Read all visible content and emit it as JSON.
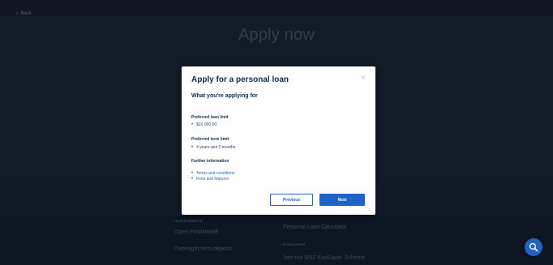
{
  "page": {
    "back_label": "Back",
    "title": "Apply now",
    "bg_left_section_label": "INVESTMENTS",
    "bg_left_items": [
      "Open FirstWealth",
      "Overnight term deposit"
    ],
    "bg_right_items_top": "Personal Loan Calculator",
    "bg_right_section_label": "KIWISAVER",
    "bg_right_items_bottom": "Join the BNZ KiwiSaver Scheme"
  },
  "modal": {
    "title": "Apply for a personal loan",
    "close_icon": "close-icon",
    "subtitle": "What you're applying for",
    "loan_limit_label": "Preferred loan limit",
    "loan_limit_value": "$10,000.00",
    "term_limit_label": "Preferred term limit",
    "term_limit_value": "4 years and 0 months",
    "further_label": "Further information",
    "links": [
      "Terms and conditions",
      "Fees and features"
    ],
    "previous_label": "Previous",
    "next_label": "Next"
  },
  "fab": {
    "icon": "search-icon"
  },
  "colors": {
    "primary_blue": "#1f63c9",
    "heading_navy": "#0e2d52",
    "background_dark": "#0f1a27"
  }
}
